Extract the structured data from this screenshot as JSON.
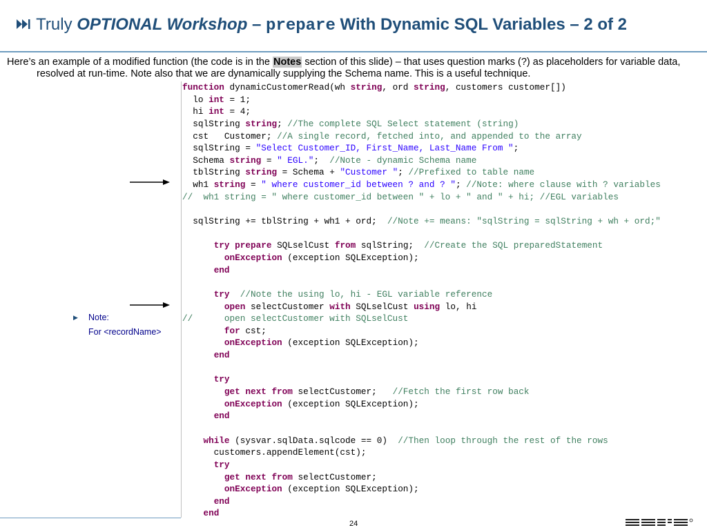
{
  "slide": {
    "title": {
      "icon": "next-track-icon",
      "prefix": "Truly ",
      "optional": "OPTIONAL Workshop",
      "dash": " – ",
      "keyword": "prepare",
      "suffix": " With Dynamic SQL Variables – 2 of 2"
    },
    "intro": {
      "part1": "Here’s an example of a modified function (the code is in the ",
      "notes": "Notes",
      "part2": " section of this slide) – that uses question marks (?) as placeholders for variable data, resolved at run-time.  Note also that we are dynamically supplying the Schema name.  This is a useful technique."
    },
    "note": {
      "label": "Note:",
      "text": "For <recordName>"
    },
    "page_number": "24",
    "colors": {
      "title": "#1f4e79",
      "keyword": "#7f0055",
      "comment": "#3f7f5f",
      "string": "#2a00ff",
      "note": "#00008b"
    }
  },
  "code_lines": [
    [
      [
        "kw",
        "function"
      ],
      [
        "tx",
        " dynamicCustomerRead(wh "
      ],
      [
        "kw",
        "string"
      ],
      [
        "tx",
        ", ord "
      ],
      [
        "kw",
        "string"
      ],
      [
        "tx",
        ", customers customer[])"
      ]
    ],
    [
      [
        "tx",
        "  lo "
      ],
      [
        "kw",
        "int"
      ],
      [
        "tx",
        " = 1;"
      ]
    ],
    [
      [
        "tx",
        "  hi "
      ],
      [
        "kw",
        "int"
      ],
      [
        "tx",
        " = 4;"
      ]
    ],
    [
      [
        "tx",
        "  sqlString "
      ],
      [
        "kw",
        "string"
      ],
      [
        "tx",
        "; "
      ],
      [
        "cm",
        "//The complete SQL Select statement (string)"
      ]
    ],
    [
      [
        "tx",
        "  cst   Customer; "
      ],
      [
        "cm",
        "//A single record, fetched into, and appended to the array"
      ]
    ],
    [
      [
        "tx",
        "  sqlString = "
      ],
      [
        "st",
        "\"Select Customer_ID, First_Name, Last_Name From \""
      ],
      [
        "tx",
        ";"
      ]
    ],
    [
      [
        "tx",
        "  Schema "
      ],
      [
        "kw",
        "string"
      ],
      [
        "tx",
        " = "
      ],
      [
        "st",
        "\" EGL.\""
      ],
      [
        "tx",
        ";  "
      ],
      [
        "cm",
        "//Note - dynamic Schema name"
      ]
    ],
    [
      [
        "tx",
        "  tblString "
      ],
      [
        "kw",
        "string"
      ],
      [
        "tx",
        " = Schema + "
      ],
      [
        "st",
        "\"Customer \""
      ],
      [
        "tx",
        "; "
      ],
      [
        "cm",
        "//Prefixed to table name"
      ]
    ],
    [
      [
        "tx",
        "  wh1 "
      ],
      [
        "kw",
        "string"
      ],
      [
        "tx",
        " = "
      ],
      [
        "st",
        "\" where customer_id between ? and ? \""
      ],
      [
        "tx",
        "; "
      ],
      [
        "cm",
        "//Note: where clause with ? variables"
      ]
    ],
    [
      [
        "cm",
        "//  wh1 string = \" where customer_id between \" + lo + \" and \" + hi; //EGL variables"
      ]
    ],
    [],
    [
      [
        "tx",
        "  sqlString += tblString + wh1 + ord;  "
      ],
      [
        "cm",
        "//Note += means: \"sqlString = sqlString + wh + ord;\""
      ]
    ],
    [],
    [
      [
        "tx",
        "      "
      ],
      [
        "kw",
        "try prepare"
      ],
      [
        "tx",
        " SQLselCust "
      ],
      [
        "kw",
        "from"
      ],
      [
        "tx",
        " sqlString;  "
      ],
      [
        "cm",
        "//Create the SQL preparedStatement"
      ]
    ],
    [
      [
        "tx",
        "        "
      ],
      [
        "kw",
        "onException"
      ],
      [
        "tx",
        " (exception SQLException);"
      ]
    ],
    [
      [
        "tx",
        "      "
      ],
      [
        "kw",
        "end"
      ]
    ],
    [],
    [
      [
        "tx",
        "      "
      ],
      [
        "kw",
        "try"
      ],
      [
        "tx",
        "  "
      ],
      [
        "cm",
        "//Note the using lo, hi - EGL variable reference"
      ]
    ],
    [
      [
        "tx",
        "        "
      ],
      [
        "kw",
        "open"
      ],
      [
        "tx",
        " selectCustomer "
      ],
      [
        "kw",
        "with"
      ],
      [
        "tx",
        " SQLselCust "
      ],
      [
        "kw",
        "using"
      ],
      [
        "tx",
        " lo, hi"
      ]
    ],
    [
      [
        "cm",
        "//      open selectCustomer with SQLselCust"
      ]
    ],
    [
      [
        "tx",
        "        "
      ],
      [
        "kw",
        "for"
      ],
      [
        "tx",
        " cst;"
      ]
    ],
    [
      [
        "tx",
        "        "
      ],
      [
        "kw",
        "onException"
      ],
      [
        "tx",
        " (exception SQLException);"
      ]
    ],
    [
      [
        "tx",
        "      "
      ],
      [
        "kw",
        "end"
      ]
    ],
    [],
    [
      [
        "tx",
        "      "
      ],
      [
        "kw",
        "try"
      ]
    ],
    [
      [
        "tx",
        "        "
      ],
      [
        "kw",
        "get next from"
      ],
      [
        "tx",
        " selectCustomer;   "
      ],
      [
        "cm",
        "//Fetch the first row back"
      ]
    ],
    [
      [
        "tx",
        "        "
      ],
      [
        "kw",
        "onException"
      ],
      [
        "tx",
        " (exception SQLException);"
      ]
    ],
    [
      [
        "tx",
        "      "
      ],
      [
        "kw",
        "end"
      ]
    ],
    [],
    [
      [
        "tx",
        "    "
      ],
      [
        "kw",
        "while"
      ],
      [
        "tx",
        " (sysvar.sqlData.sqlcode == 0)  "
      ],
      [
        "cm",
        "//Then loop through the rest of the rows"
      ]
    ],
    [
      [
        "tx",
        "      customers.appendElement(cst);"
      ]
    ],
    [
      [
        "tx",
        "      "
      ],
      [
        "kw",
        "try"
      ]
    ],
    [
      [
        "tx",
        "        "
      ],
      [
        "kw",
        "get next from"
      ],
      [
        "tx",
        " selectCustomer;"
      ]
    ],
    [
      [
        "tx",
        "        "
      ],
      [
        "kw",
        "onException"
      ],
      [
        "tx",
        " (exception SQLException);"
      ]
    ],
    [
      [
        "tx",
        "      "
      ],
      [
        "kw",
        "end"
      ]
    ],
    [
      [
        "tx",
        "    "
      ],
      [
        "kw",
        "end"
      ]
    ]
  ]
}
